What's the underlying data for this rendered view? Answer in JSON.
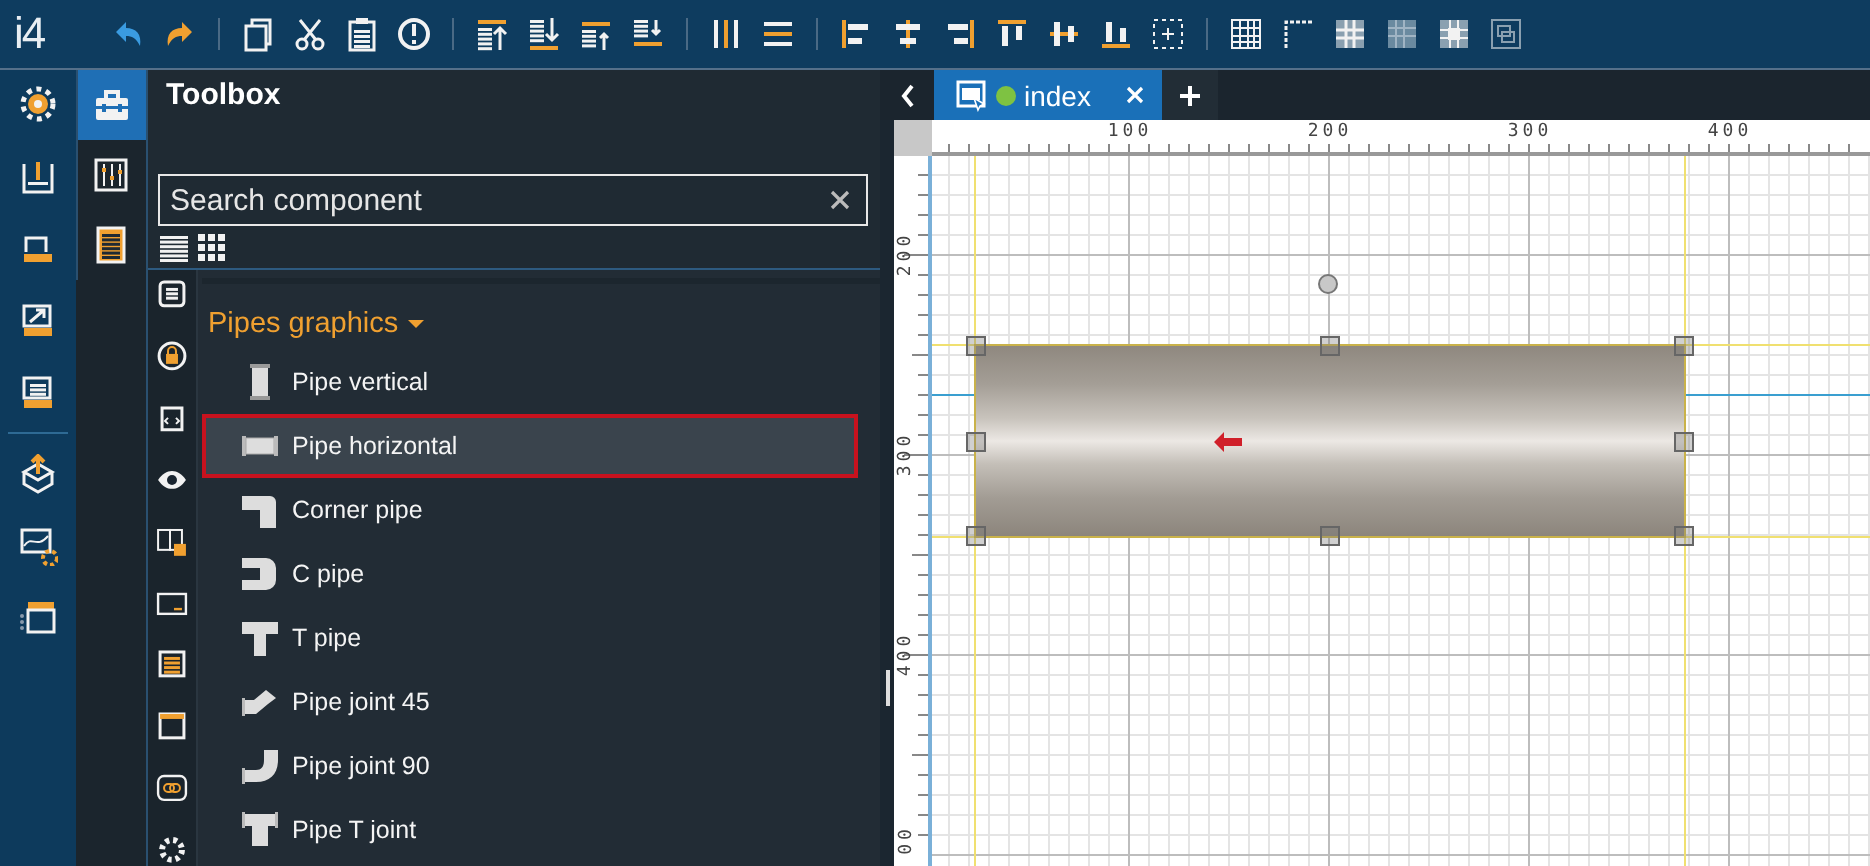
{
  "toolbar": {
    "logo": "i4"
  },
  "nav": [
    {
      "selected": true
    },
    {
      "selected": false
    },
    {
      "selected": false
    }
  ],
  "toolbox": {
    "title": "Toolbox",
    "search": {
      "placeholder": "Search component"
    },
    "category": {
      "label": "Pipes graphics",
      "expanded": true
    },
    "items": [
      {
        "label": "Pipe vertical",
        "kind": "vertical",
        "selected": false
      },
      {
        "label": "Pipe horizontal",
        "kind": "horizontal",
        "selected": true
      },
      {
        "label": "Corner pipe",
        "kind": "corner",
        "selected": false
      },
      {
        "label": "C pipe",
        "kind": "c",
        "selected": false
      },
      {
        "label": "T pipe",
        "kind": "t",
        "selected": false
      },
      {
        "label": "Pipe joint 45",
        "kind": "joint45",
        "selected": false
      },
      {
        "label": "Pipe joint 90",
        "kind": "joint90",
        "selected": false
      },
      {
        "label": "Pipe T joint",
        "kind": "tjoint",
        "selected": false
      }
    ]
  },
  "editor": {
    "tabs": [
      {
        "label": "index",
        "selected": true
      }
    ],
    "ruler": {
      "x_labels": [
        "100",
        "200",
        "300",
        "400"
      ],
      "y_labels": [
        "200",
        "300",
        "400",
        "00"
      ]
    },
    "canvas": {
      "pipe": {
        "selected": true
      }
    }
  }
}
